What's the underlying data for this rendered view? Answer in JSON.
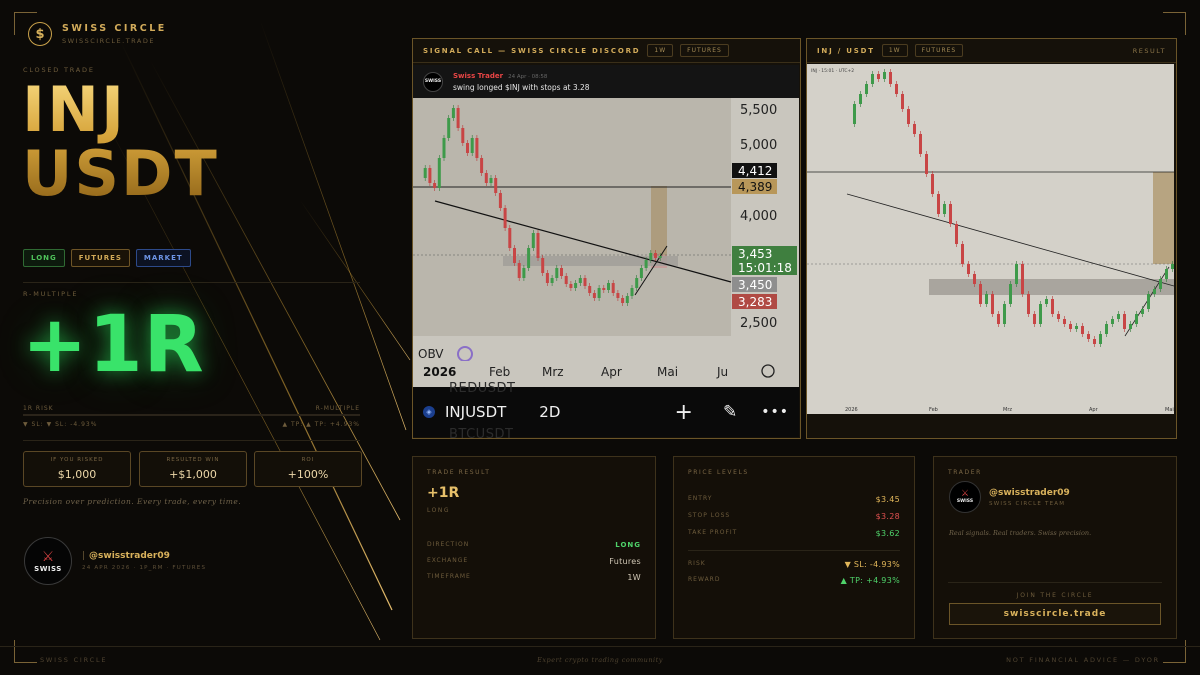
{
  "brand": {
    "name": "SWISS CIRCLE",
    "sub": "SWISSCIRCLE.TRADE",
    "logo_icon": "dollar-coin-icon"
  },
  "trade": {
    "status": "CLOSED TRADE",
    "base": "INJ",
    "quote": "USDT",
    "tags": [
      "LONG",
      "FUTURES",
      "MARKET"
    ],
    "r_label": "R-MULTIPLE",
    "r_value": "+1R",
    "risk_label": "1R RISK",
    "rm_label": "R-MULTIPLE",
    "sl_text": "▼ SL: ▼ SL: -4.93%",
    "tp_text": "▲ TP: ▲ TP: +4.93%",
    "r_progress": 0.0
  },
  "stats": [
    {
      "label": "IF YOU RISKED",
      "value": "$1,000"
    },
    {
      "label": "RESULTED WIN",
      "value": "+$1,000"
    },
    {
      "label": "ROI",
      "value": "+100%"
    }
  ],
  "tagline": "Precision over prediction. Every trade, every time.",
  "trader_left": {
    "handle": "@swisstrader09",
    "meta": "24 APR 2026 · 1P_RM · FUTURES",
    "avatar_text": "SWISS"
  },
  "signal_panel": {
    "title": "SIGNAL CALL — SWISS CIRCLE DISCORD",
    "pills": [
      "1W",
      "FUTURES"
    ],
    "discord": {
      "name": "Swiss Trader",
      "time": "24 Apr · 08:58",
      "message": "swing longed $INJ with stops at 3.28"
    },
    "y_ticks": [
      "5,500",
      "5,000",
      "4,000",
      "2,500"
    ],
    "price_tags": [
      {
        "text": "4,412",
        "color": "#111111"
      },
      {
        "text": "4,389",
        "color": "#b8975a"
      },
      {
        "text": "3,453",
        "color": "#3f7f3f"
      },
      {
        "text": "15:01:18",
        "color": "#3f7f3f"
      },
      {
        "text": "3,450",
        "color": "#8e8e8e"
      },
      {
        "text": "3,283",
        "color": "#b04a44"
      }
    ],
    "x_ticks": [
      "2026",
      "Feb",
      "Mrz",
      "Apr",
      "Mai",
      "Ju"
    ],
    "indicator": "OBV",
    "symbol": "INJUSDT",
    "timeframe": "2D",
    "ghost_top": "REDUSDT",
    "ghost_bottom": "BTCUSDT"
  },
  "result_panel": {
    "title": "INJ / USDT",
    "pills": [
      "1W",
      "FUTURES"
    ],
    "right": "RESULT",
    "header_text": "INJ · 15:01 · UTC+2",
    "x_ticks": [
      "2026",
      "Feb",
      "Mrz",
      "Apr",
      "Mai"
    ]
  },
  "cards": {
    "result": {
      "label": "TRADE RESULT",
      "value": "+1R",
      "side": "LONG",
      "rows": [
        {
          "k": "DIRECTION",
          "v": "LONG"
        },
        {
          "k": "EXCHANGE",
          "v": "Futures"
        },
        {
          "k": "TIMEFRAME",
          "v": "1W"
        }
      ]
    },
    "levels": {
      "label": "PRICE LEVELS",
      "rows": [
        {
          "k": "ENTRY",
          "v": "$3.45"
        },
        {
          "k": "STOP LOSS",
          "v": "$3.28"
        },
        {
          "k": "TAKE PROFIT",
          "v": "$3.62"
        },
        {
          "k": "RISK",
          "v": "▼ SL: -4.93%"
        },
        {
          "k": "REWARD",
          "v": "▲ TP: +4.93%"
        }
      ]
    },
    "trader": {
      "label": "TRADER",
      "handle": "@swisstrader09",
      "team": "SWISS CIRCLE TEAM",
      "quote": "Real signals. Real traders. Swiss precision.",
      "join_label": "JOIN THE CIRCLE",
      "join_button": "swisscircle.trade"
    }
  },
  "footer": {
    "left": "SWISS CIRCLE",
    "center": "Expert crypto trading community",
    "right": "NOT FINANCIAL ADVICE — DYOR"
  },
  "colors": {
    "gold": "#d2ab5a",
    "green": "#39e36a",
    "red": "#e05050",
    "bg": "#0c0a07"
  },
  "chart_data": {
    "type": "candlestick",
    "title": "INJUSDT 2D",
    "levels": {
      "entry": 3.45,
      "stop": 3.283,
      "target": 3.62,
      "resistance": 4.389,
      "price_now": 3.453
    },
    "y_ticks": [
      5.5,
      5.0,
      4.0,
      2.5
    ],
    "x_labels": [
      "2026",
      "Feb",
      "Mrz",
      "Apr",
      "Mai",
      "Ju"
    ]
  }
}
